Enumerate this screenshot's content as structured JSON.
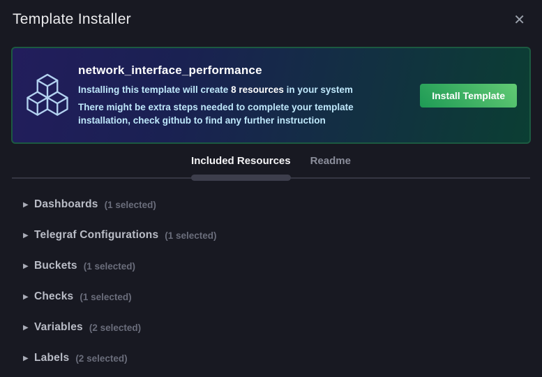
{
  "header": {
    "title": "Template Installer"
  },
  "icons": {
    "close": "✕",
    "caret": "▶",
    "cubes": "template-cubes-icon"
  },
  "banner": {
    "template_name": "network_interface_performance",
    "resources_line": {
      "prefix": "Installing this template will create ",
      "bold": "8 resources",
      "suffix": " in your system"
    },
    "note_line": "There might be extra steps needed to complete your template installation, check github to find any further instruction",
    "install_button_label": "Install Template"
  },
  "tabs": [
    {
      "label": "Included Resources",
      "active": true
    },
    {
      "label": "Readme",
      "active": false
    }
  ],
  "resources": [
    {
      "label": "Dashboards",
      "count": "(1 selected)"
    },
    {
      "label": "Telegraf Configurations",
      "count": "(1 selected)"
    },
    {
      "label": "Buckets",
      "count": "(1 selected)"
    },
    {
      "label": "Checks",
      "count": "(1 selected)"
    },
    {
      "label": "Variables",
      "count": "(2 selected)"
    },
    {
      "label": "Labels",
      "count": "(2 selected)"
    }
  ],
  "colors": {
    "page_background": "#181922",
    "banner_gradient_start": "#221d5c",
    "banner_gradient_end": "#0b3e33",
    "banner_border": "#1c5a41",
    "banner_body_text": "#bfe8fb",
    "button_gradient_start": "#1e9a55",
    "button_gradient_end": "#62ca74",
    "icon_stroke": "#b3d2f0",
    "active_tab_underline": "#3d3e4c",
    "divider": "#363743"
  }
}
